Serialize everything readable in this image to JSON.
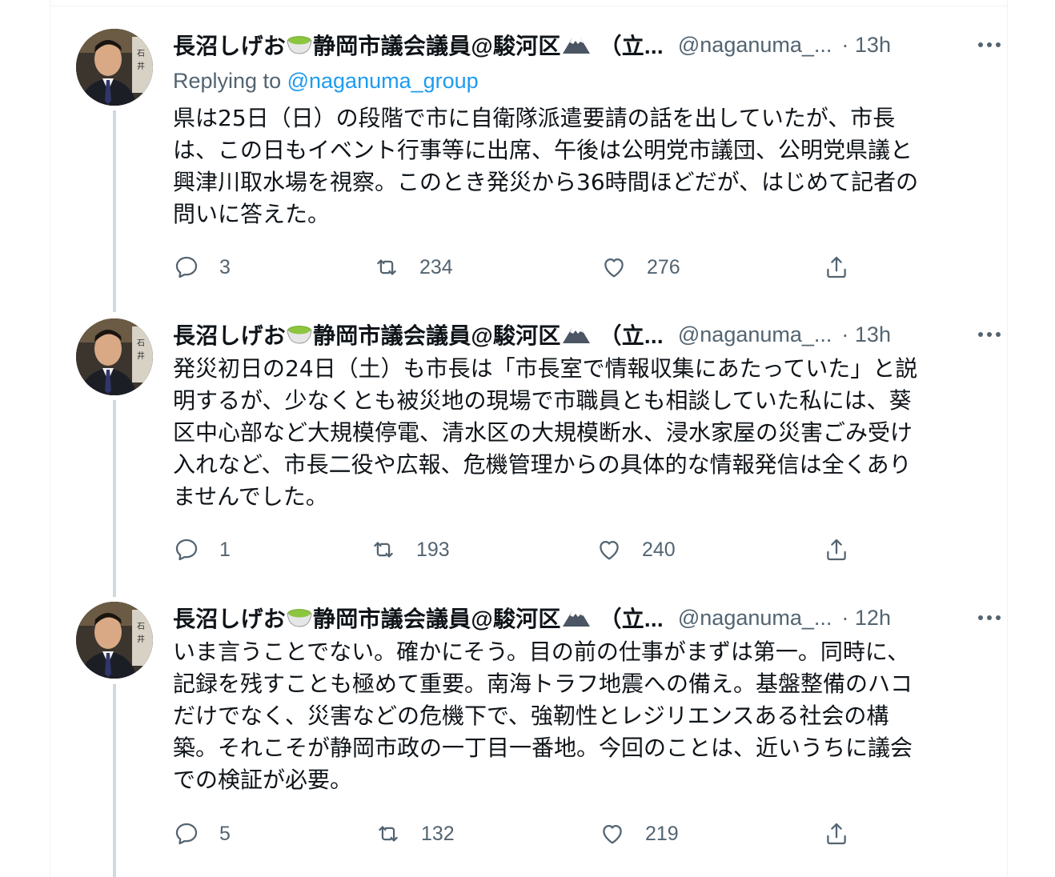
{
  "colors": {
    "text": "#0f1419",
    "secondary": "#536471",
    "link": "#1d9bf0",
    "thread_line": "#cfd9de",
    "border": "#eff3f4"
  },
  "tweets": [
    {
      "author_name": "長沼しげお",
      "author_title": "静岡市議会議員@駿河区",
      "author_suffix": "（立...",
      "handle": "@naganuma_...",
      "time": "· 13h",
      "replying_prefix": "Replying to ",
      "replying_to": "@naganuma_group",
      "text": "県は25日（日）の段階で市に自衛隊派遣要請の話を出していたが、市長\nは、この日もイベント行事等に出席、午後は公明党市議団、公明党県議と\n興津川取水場を視察。このとき発災から36時間ほどだが、はじめて記者の\n問いに答えた。",
      "replies": "3",
      "retweets": "234",
      "likes": "276"
    },
    {
      "author_name": "長沼しげお",
      "author_title": "静岡市議会議員@駿河区",
      "author_suffix": "（立...",
      "handle": "@naganuma_...",
      "time": "· 13h",
      "text": "発災初日の24日（土）も市長は「市長室で情報収集にあたっていた」と説\n明するが、少なくとも被災地の現場で市職員とも相談していた私には、葵\n区中心部など大規模停電、清水区の大規模断水、浸水家屋の災害ごみ受け\n入れなど、市長二役や広報、危機管理からの具体的な情報発信は全くあり\nませんでした。",
      "replies": "1",
      "retweets": "193",
      "likes": "240"
    },
    {
      "author_name": "長沼しげお",
      "author_title": "静岡市議会議員@駿河区",
      "author_suffix": "（立...",
      "handle": "@naganuma_...",
      "time": "· 12h",
      "text": "いま言うことでない。確かにそう。目の前の仕事がまずは第一。同時に、\n記録を残すことも極めて重要。南海トラフ地震への備え。基盤整備のハコ\nだけでなく、災害などの危機下で、強靭性とレジリエンスある社会の構\n築。それこそが静岡市政の一丁目一番地。今回のことは、近いうちに議会\nでの検証が必要。",
      "replies": "5",
      "retweets": "132",
      "likes": "219"
    }
  ]
}
